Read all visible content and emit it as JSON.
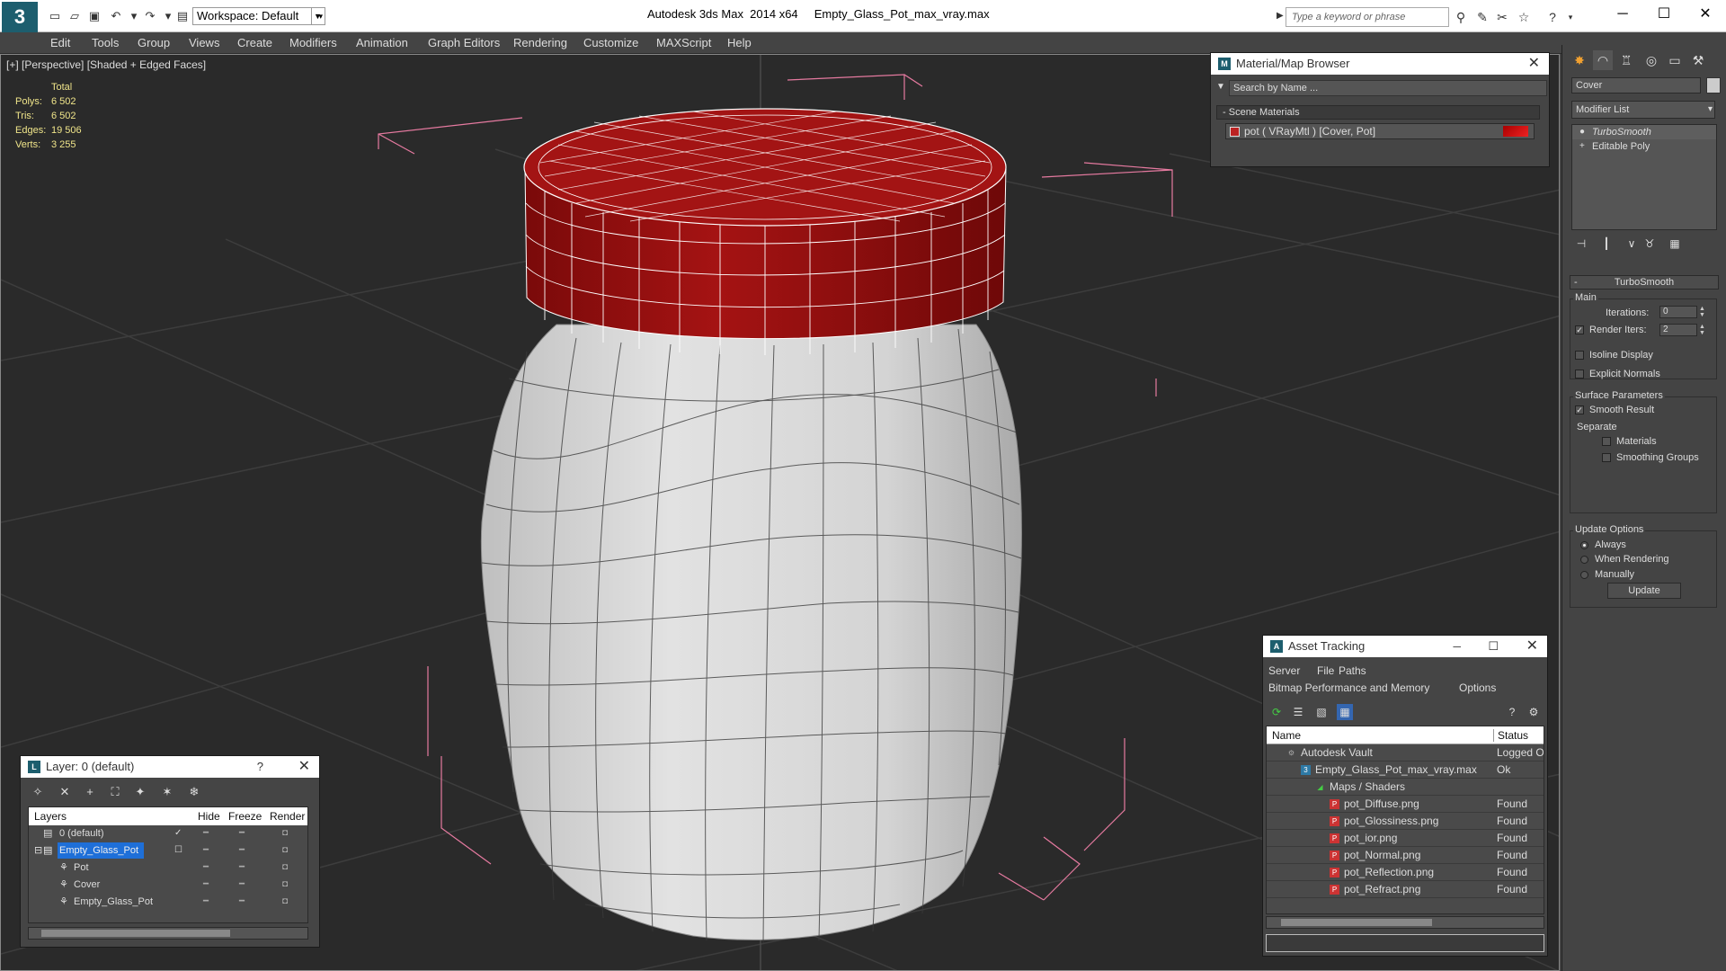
{
  "titlebar": {
    "app_logo": "3",
    "workspace": "Workspace: Default",
    "app_title": "Autodesk 3ds Max  2014 x64",
    "file_name": "Empty_Glass_Pot_max_vray.max",
    "search_placeholder": "Type a keyword or phrase"
  },
  "menu": [
    "Edit",
    "Tools",
    "Group",
    "Views",
    "Create",
    "Modifiers",
    "Animation",
    "Graph Editors",
    "Rendering",
    "Customize",
    "MAXScript",
    "Help"
  ],
  "viewport": {
    "label": "[+] [Perspective] [Shaded + Edged Faces]",
    "stats": {
      "header": "Total",
      "rows": [
        {
          "label": "Polys:",
          "value": "6 502"
        },
        {
          "label": "Tris:",
          "value": "6 502"
        },
        {
          "label": "Edges:",
          "value": "19 506"
        },
        {
          "label": "Verts:",
          "value": "3 255"
        }
      ]
    },
    "colors": {
      "cover": "#8b0e0e",
      "cover_light": "#b01818",
      "jar": "#d9d9d9",
      "grid": "#3c3c3c",
      "bbox": "#e67aa0"
    }
  },
  "material_browser": {
    "title": "Material/Map Browser",
    "search_placeholder": "Search by Name ...",
    "group_label": "Scene Materials",
    "item_label": "pot  ( VRayMtl ) [Cover, Pot]"
  },
  "command_panel": {
    "object_name": "Cover",
    "modifier_list": "Modifier List",
    "stack": [
      "TurboSmooth",
      "Editable Poly"
    ],
    "rollout_title": "TurboSmooth",
    "main_group": "Main",
    "iterations_label": "Iterations:",
    "iterations_value": "0",
    "render_iters_label": "Render Iters:",
    "render_iters_value": "2",
    "isoline_label": "Isoline Display",
    "explicit_label": "Explicit Normals",
    "surface_group": "Surface Parameters",
    "smooth_label": "Smooth Result",
    "separate_label": "Separate",
    "materials_label": "Materials",
    "smoothing_label": "Smoothing Groups",
    "update_group": "Update Options",
    "always_label": "Always",
    "when_render_label": "When Rendering",
    "manually_label": "Manually",
    "update_button": "Update"
  },
  "asset_tracking": {
    "title": "Asset Tracking",
    "menu1": [
      "Server",
      "File",
      "Paths"
    ],
    "menu2": [
      "Bitmap Performance and Memory",
      "Options"
    ],
    "col_name": "Name",
    "col_status": "Status",
    "rows": [
      {
        "name": "Autodesk Vault",
        "status": "Logged Out"
      },
      {
        "name": "Empty_Glass_Pot_max_vray.max",
        "status": "Ok"
      },
      {
        "name": "Maps / Shaders",
        "status": ""
      },
      {
        "name": "pot_Diffuse.png",
        "status": "Found"
      },
      {
        "name": "pot_Glossiness.png",
        "status": "Found"
      },
      {
        "name": "pot_ior.png",
        "status": "Found"
      },
      {
        "name": "pot_Normal.png",
        "status": "Found"
      },
      {
        "name": "pot_Reflection.png",
        "status": "Found"
      },
      {
        "name": "pot_Refract.png",
        "status": "Found"
      }
    ]
  },
  "layer_manager": {
    "title": "Layer: 0 (default)",
    "help": "?",
    "col_layers": "Layers",
    "col_hide": "Hide",
    "col_freeze": "Freeze",
    "col_render": "Render",
    "rows": [
      "0 (default)",
      "Empty_Glass_Pot",
      "Pot",
      "Cover",
      "Empty_Glass_Pot"
    ]
  }
}
